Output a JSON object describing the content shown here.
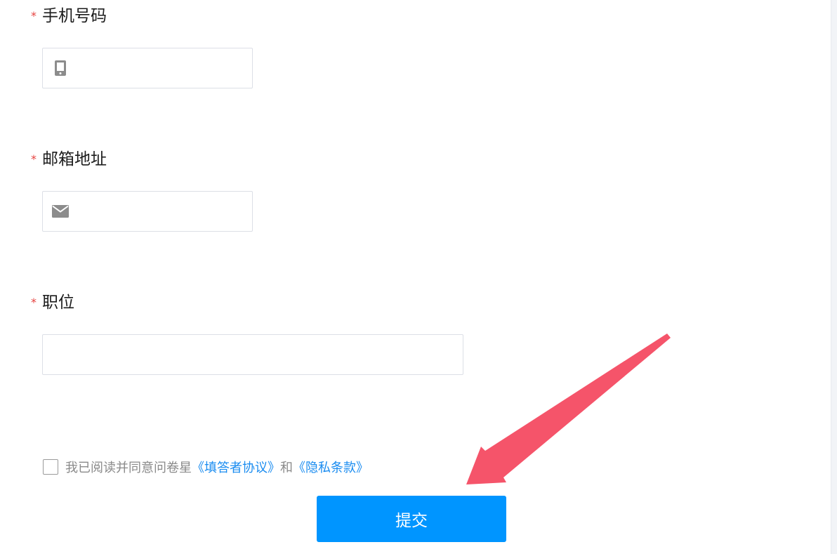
{
  "form": {
    "phone": {
      "required_mark": "*",
      "label": "手机号码",
      "value": "",
      "icon": "mobile-phone-icon"
    },
    "email": {
      "required_mark": "*",
      "label": "邮箱地址",
      "value": "",
      "icon": "envelope-icon"
    },
    "position": {
      "required_mark": "*",
      "label": "职位",
      "value": ""
    }
  },
  "agreement": {
    "prefix": "我已阅读并同意问卷星",
    "link1": "《填答者协议》",
    "joiner": "和",
    "link2": "《隐私条款》",
    "checked": false
  },
  "submit": {
    "label": "提交"
  },
  "annotation": {
    "arrow_color": "#f5546a"
  },
  "colors": {
    "required": "#e64340",
    "link": "#1a8cf0",
    "button": "#0095ff"
  }
}
